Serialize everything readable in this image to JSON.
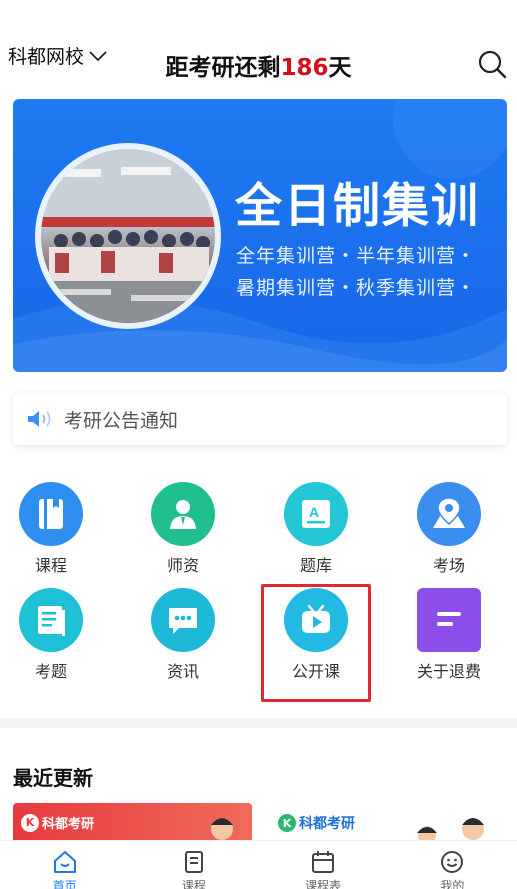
{
  "header": {
    "school_label": "科都网校",
    "title_prefix": "距考研还剩",
    "title_days": "186",
    "title_suffix": "天"
  },
  "banner": {
    "headline": "全日制集训",
    "line1": "全年集训营・半年集训营・",
    "line2": "暑期集训营・秋季集训营・"
  },
  "notice": {
    "text": "考研公告通知"
  },
  "grid": [
    {
      "label": "课程",
      "icon": "book-icon",
      "color": "#2f8ff0"
    },
    {
      "label": "师资",
      "icon": "teacher-icon",
      "color": "#1fbf8f"
    },
    {
      "label": "题库",
      "icon": "question-bank-icon",
      "color": "#23c7d6"
    },
    {
      "label": "考场",
      "icon": "map-pin-icon",
      "color": "#3a8ef0"
    },
    {
      "label": "考题",
      "icon": "exam-paper-icon",
      "color": "#1ec0d6"
    },
    {
      "label": "资讯",
      "icon": "chat-icon",
      "color": "#1fb9d8"
    },
    {
      "label": "公开课",
      "icon": "tv-play-icon",
      "color": "#22b9e2"
    },
    {
      "label": "关于退费",
      "icon": "document-lines-icon",
      "color": "#8c4ee8"
    }
  ],
  "recent": {
    "title": "最近更新",
    "cards": [
      {
        "brand": "科都考研"
      },
      {
        "brand": "科都考研"
      }
    ]
  },
  "tabbar": [
    {
      "label": "首页",
      "icon": "home-icon",
      "active": true
    },
    {
      "label": "课程",
      "icon": "course-book-icon",
      "active": false
    },
    {
      "label": "课程表",
      "icon": "calendar-icon",
      "active": false
    },
    {
      "label": "我的",
      "icon": "smile-face-icon",
      "active": false
    }
  ],
  "colors": {
    "accent": "#1d7bf0",
    "countdown_red": "#d0101a",
    "highlight_red": "#e0282e"
  }
}
